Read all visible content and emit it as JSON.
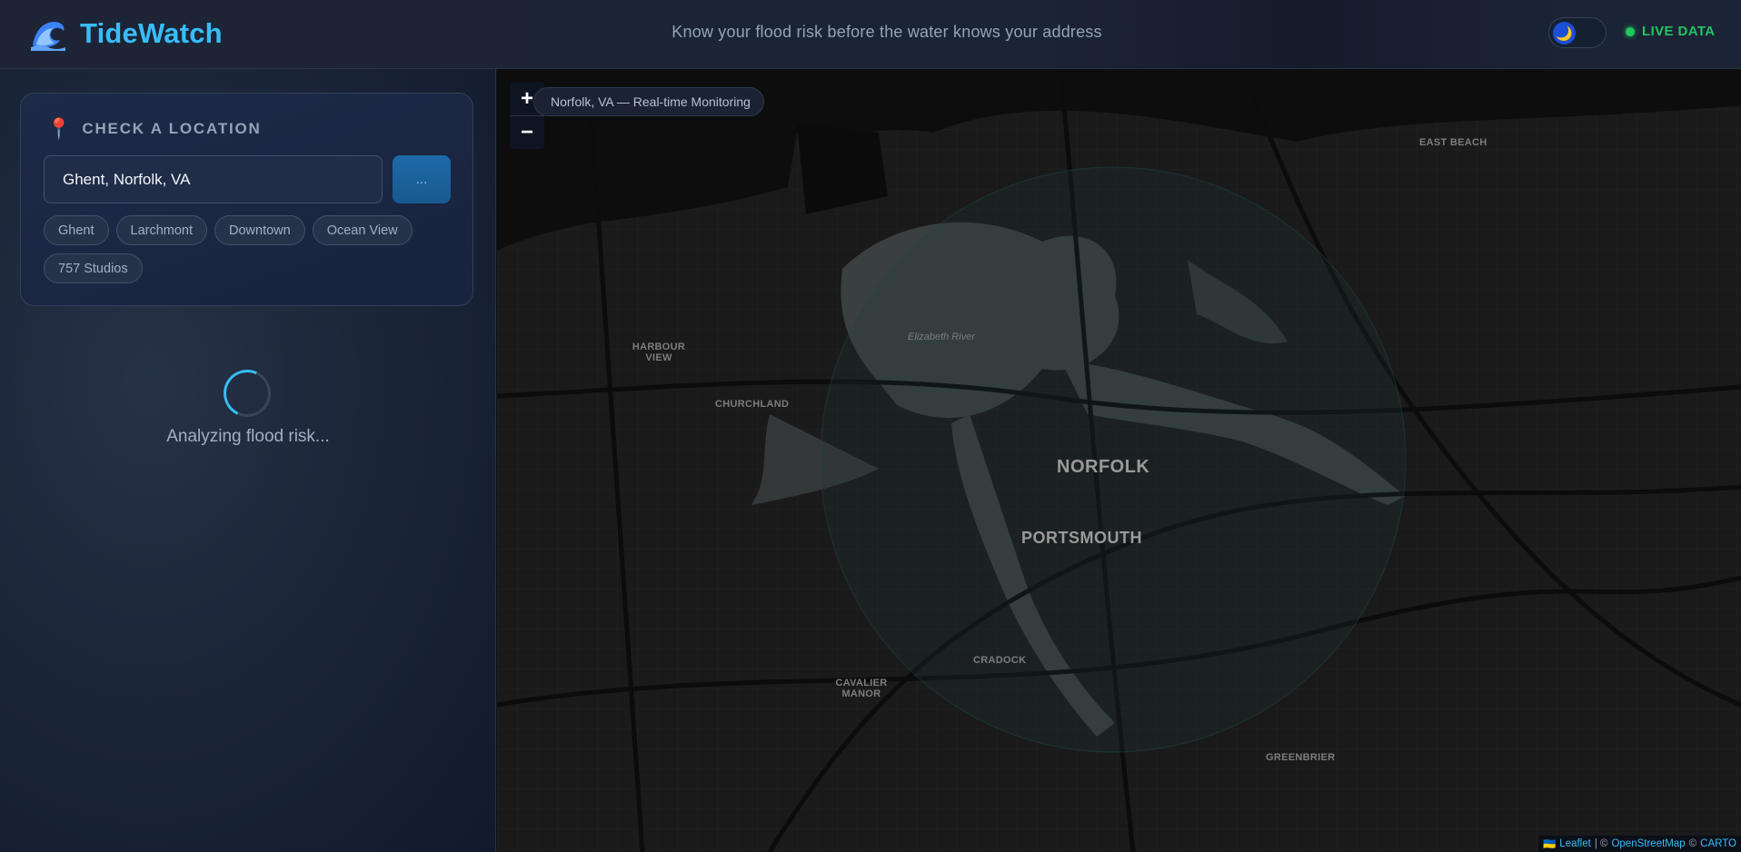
{
  "header": {
    "app_name": "TideWatch",
    "tagline": "Know your flood risk before the water knows your address",
    "theme_icon": "moon-icon",
    "live_label": "LIVE DATA",
    "accent": "#38bdf8",
    "live_color": "#22c55e"
  },
  "sidebar": {
    "card_title": "CHECK A LOCATION",
    "search": {
      "value": "Ghent, Norfolk, VA",
      "button_label": "..."
    },
    "quick_picks": [
      "Ghent",
      "Larchmont",
      "Downtown",
      "Ocean View",
      "757 Studios"
    ],
    "loading_text": "Analyzing flood risk..."
  },
  "map": {
    "zoom_in": "+",
    "zoom_out": "−",
    "location_label": "Norfolk, VA — Real-time Monitoring",
    "places": {
      "norfolk": "NORFOLK",
      "portsmouth": "PORTSMOUTH",
      "churchland": "CHURCHLAND",
      "harbour_view": "HARBOUR VIEW",
      "cradock": "CRADOCK",
      "cavalier_manor": "CAVALIER MANOR",
      "greenbrier": "GREENBRIER",
      "east_beach": "EAST BEACH",
      "elizabeth_river": "Elizabeth River"
    },
    "attribution": {
      "leaflet": "Leaflet",
      "separator": "| ©",
      "osm": "OpenStreetMap",
      "copy": "©",
      "carto": "CARTO"
    }
  }
}
